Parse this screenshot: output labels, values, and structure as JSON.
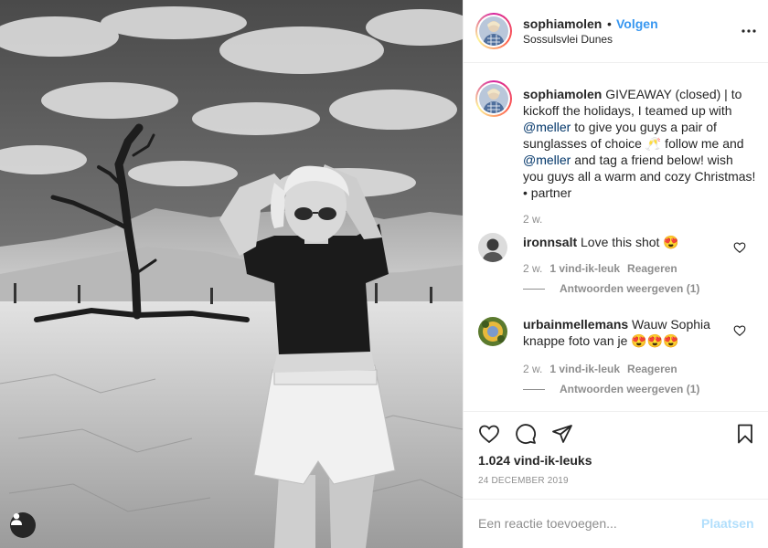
{
  "post": {
    "username": "sophiamolen",
    "separator": "•",
    "follow_label": "Volgen",
    "location": "Sossulsvlei Dunes",
    "more_icon": "more-options-icon"
  },
  "caption": {
    "username": "sophiamolen",
    "part1": "GIVEAWAY (closed) | to kickoff the holidays, I teamed up with ",
    "mention1": "@meller",
    "part2": " to give you guys a pair of sunglasses of choice 🥂 follow me and ",
    "mention2": "@meller",
    "part3": " and tag a friend below! wish you guys all a warm and cozy Christmas! • partner",
    "time": "2 w."
  },
  "comments": [
    {
      "username": "ironnsalt",
      "text": "Love this shot 😍",
      "time": "2 w.",
      "likes": "1 vind-ik-leuk",
      "reply_label": "Reageren",
      "view_replies": "Antwoorden weergeven (1)"
    },
    {
      "username": "urbainmellemans",
      "text": "Wauw Sophia knappe foto van je 😍😍😍",
      "time": "2 w.",
      "likes": "1 vind-ik-leuk",
      "reply_label": "Reageren",
      "view_replies": "Antwoorden weergeven (1)"
    }
  ],
  "actions": {
    "icons": [
      "heart-icon",
      "comment-icon",
      "share-icon",
      "bookmark-icon"
    ],
    "likes_count": "1.024 vind-ik-leuks",
    "date": "24 DECEMBER 2019"
  },
  "add_comment": {
    "placeholder": "Een reactie toevoegen...",
    "post_label": "Plaatsen"
  },
  "colors": {
    "link_blue": "#3897f0",
    "mention_blue": "#003569",
    "muted_gray": "#8e8e8e",
    "disabled_blue": "#b2dffc"
  }
}
